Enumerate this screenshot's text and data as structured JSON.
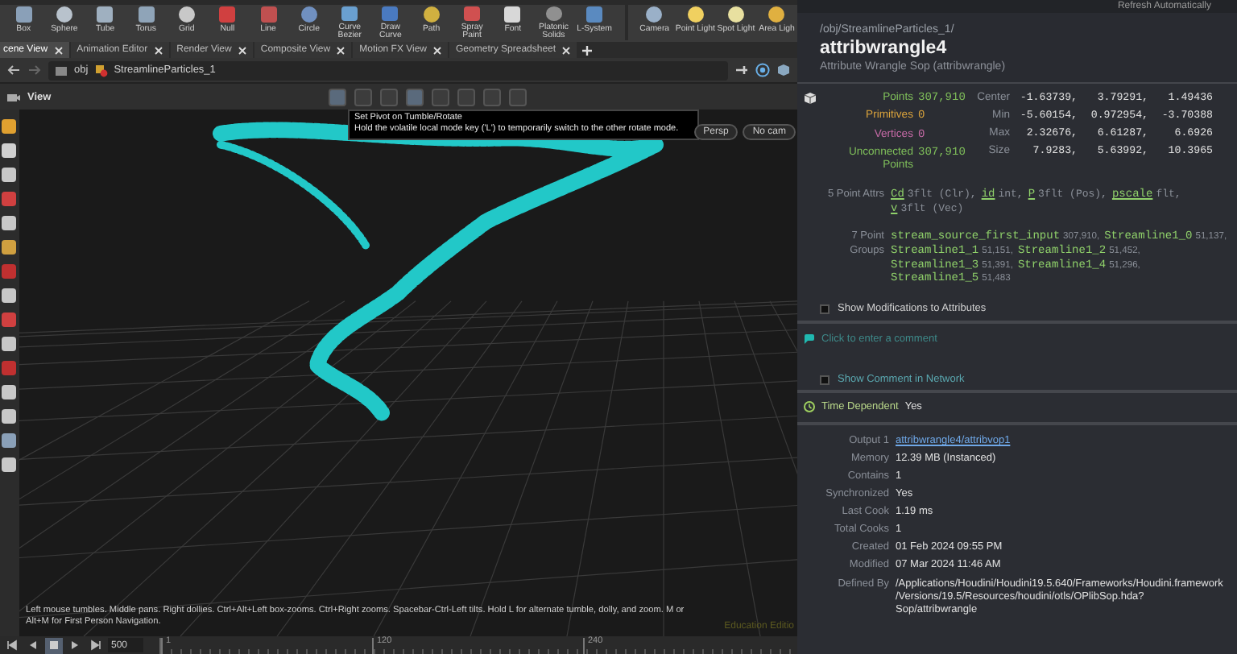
{
  "shelf": {
    "tools": [
      {
        "label": "Box"
      },
      {
        "label": "Sphere"
      },
      {
        "label": "Tube"
      },
      {
        "label": "Torus"
      },
      {
        "label": "Grid"
      },
      {
        "label": "Null"
      },
      {
        "label": "Line"
      },
      {
        "label": "Circle"
      },
      {
        "label": "Curve Bezier"
      },
      {
        "label": "Draw Curve"
      },
      {
        "label": "Path"
      },
      {
        "label": "Spray Paint"
      },
      {
        "label": "Font"
      },
      {
        "label": "Platonic Solids"
      },
      {
        "label": "L-System"
      }
    ],
    "lights": [
      {
        "label": "Camera"
      },
      {
        "label": "Point Light"
      },
      {
        "label": "Spot Light"
      },
      {
        "label": "Area Ligh"
      }
    ]
  },
  "pane_tabs": [
    {
      "label": "cene View",
      "selected": true
    },
    {
      "label": "Animation Editor",
      "selected": false
    },
    {
      "label": "Render View",
      "selected": false
    },
    {
      "label": "Composite View",
      "selected": false
    },
    {
      "label": "Motion FX View",
      "selected": false
    },
    {
      "label": "Geometry Spreadsheet",
      "selected": false
    }
  ],
  "path_bar": {
    "items": [
      "obj",
      "StreamlineParticles_1"
    ]
  },
  "viewport": {
    "title": "View",
    "tooltip": {
      "title": "Set Pivot on Tumble/Rotate",
      "body": "Hold the volatile local mode key ('L') to temporarily switch to the other rotate mode."
    },
    "view_buttons": [
      "Persp",
      "No cam"
    ],
    "help_text": "Left mouse tumbles. Middle pans. Right dollies. Ctrl+Alt+Left box-zooms. Ctrl+Right zooms. Spacebar-Ctrl-Left tilts. Hold L for alternate tumble, dolly, and zoom.    M or Alt+M for First Person Navigation.",
    "edition": "Education Editio"
  },
  "timeline": {
    "frame": "500",
    "ticks": [
      "1",
      "120",
      "240"
    ]
  },
  "info": {
    "top_label": "Refresh Automatically",
    "path": "/obj/StreamlineParticles_1/",
    "node_name": "attribwrangle4",
    "node_type": "Attribute Wrangle Sop (attribwrangle)",
    "counts": [
      {
        "label": "Points",
        "value": "307,910",
        "color": "#7fbf5a"
      },
      {
        "label": "Primitives",
        "value": "0",
        "color": "#d9a23c"
      },
      {
        "label": "Vertices",
        "value": "0",
        "color": "#c56aa6"
      },
      {
        "label": "Unconnected Points",
        "value": "307,910",
        "color": "#7fbf5a"
      }
    ],
    "bounds": [
      {
        "label": "Center",
        "values": [
          "-1.63739,",
          "3.79291,",
          "1.49436"
        ]
      },
      {
        "label": "Min",
        "values": [
          "-5.60154,",
          "0.972954,",
          "-3.70388"
        ]
      },
      {
        "label": "Max",
        "values": [
          "2.32676,",
          "6.61287,",
          "6.6926"
        ]
      },
      {
        "label": "Size",
        "values": [
          "7.9283,",
          "5.63992,",
          "10.3965"
        ]
      }
    ],
    "point_attrs": {
      "label": "5 Point Attrs",
      "attrs": [
        {
          "name": "Cd",
          "type": "3flt (Clr),"
        },
        {
          "name": "id",
          "type": "int,"
        },
        {
          "name": "P",
          "type": "3flt (Pos),"
        },
        {
          "name": "pscale",
          "type": "flt,"
        },
        {
          "name": "v",
          "type": "3flt (Vec)"
        }
      ]
    },
    "groups": {
      "label": "7 Point Groups",
      "items": [
        {
          "name": "stream_source_first_input",
          "count": "307,910,"
        },
        {
          "name": "Streamline1_0",
          "count": "51,137,"
        },
        {
          "name": "Streamline1_1",
          "count": "51,151,"
        },
        {
          "name": "Streamline1_2",
          "count": "51,452,"
        },
        {
          "name": "Streamline1_3",
          "count": "51,391,"
        },
        {
          "name": "Streamline1_4",
          "count": "51,296,"
        },
        {
          "name": "Streamline1_5",
          "count": "51,483"
        }
      ]
    },
    "show_modifications": {
      "label": "Show Modifications to Attributes",
      "checked": false
    },
    "comment_placeholder": "Click to enter a comment",
    "show_comment": {
      "label": "Show Comment in Network",
      "checked": false
    },
    "time_dependent": {
      "label": "Time Dependent",
      "value": "Yes"
    },
    "details": [
      {
        "label": "Output 1",
        "value": "attribwrangle4/attribvop1",
        "kind": "link"
      },
      {
        "label": "Memory",
        "value": "12.39 MB (Instanced)",
        "kind": "text"
      },
      {
        "label": "Contains",
        "value": "1",
        "kind": "text"
      },
      {
        "label": "Synchronized",
        "value": "Yes",
        "kind": "text"
      },
      {
        "label": "Last Cook",
        "value": "1.19 ms",
        "kind": "text"
      },
      {
        "label": "Total Cooks",
        "value": "1",
        "kind": "text"
      },
      {
        "label": "Created",
        "value": "01 Feb 2024 09:55 PM",
        "kind": "text"
      },
      {
        "label": "Modified",
        "value": "07 Mar 2024 11:46 AM",
        "kind": "text"
      },
      {
        "label": "Defined By",
        "value": "/Applications/Houdini/Houdini19.5.640/Frameworks/Houdini.framework/Versions/19.5/Resources/houdini/otls/OPlibSop.hda?Sop/attribwrangle",
        "kind": "text"
      }
    ]
  }
}
